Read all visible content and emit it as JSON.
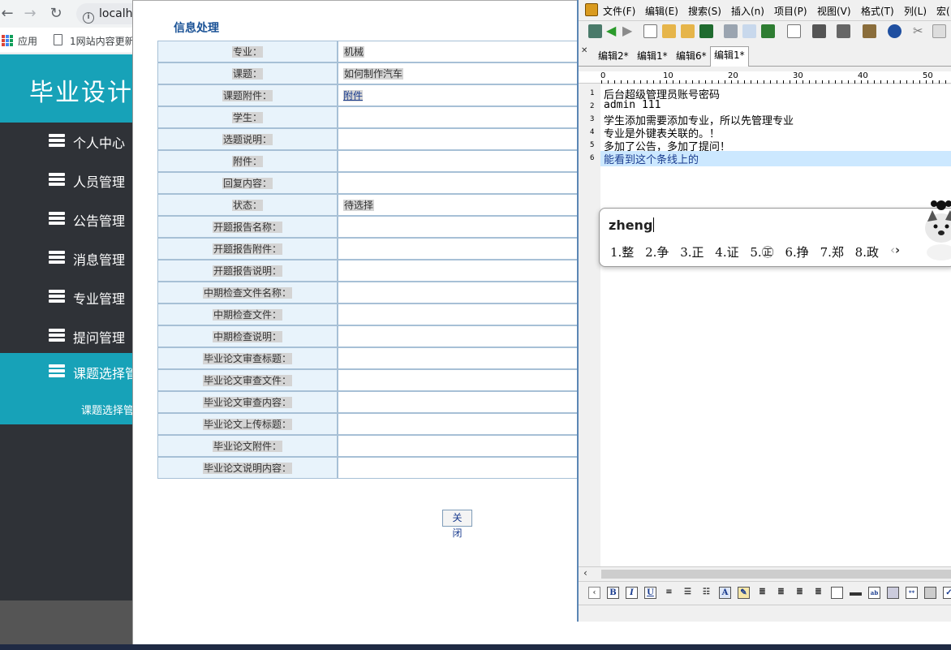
{
  "browser": {
    "back_icon": "arrow-left-icon",
    "forward_icon": "arrow-right-icon",
    "reload_icon": "reload-icon",
    "info_icon": "info-icon",
    "url": "localh",
    "apps_label": "应用",
    "bookmark_label": "1网站内容更新"
  },
  "app": {
    "title": "毕业设计",
    "sidebar": [
      {
        "label": "个人中心",
        "icon": "stack-icon"
      },
      {
        "label": "人员管理",
        "icon": "stack-icon"
      },
      {
        "label": "公告管理",
        "icon": "stack-icon"
      },
      {
        "label": "消息管理",
        "icon": "stack-icon"
      },
      {
        "label": "专业管理",
        "icon": "stack-icon"
      },
      {
        "label": "提问管理",
        "icon": "stack-icon"
      },
      {
        "label": "课题选择管",
        "icon": "stack-icon",
        "active": true
      }
    ],
    "sidebar_sub": "课题选择管"
  },
  "modal": {
    "title": "信息处理",
    "rows": [
      {
        "label": "专业：",
        "value": "机械"
      },
      {
        "label": "课题：",
        "value": "如何制作汽车"
      },
      {
        "label": "课题附件：",
        "value": "附件",
        "link": true
      },
      {
        "label": "学生：",
        "value": ""
      },
      {
        "label": "选题说明：",
        "value": ""
      },
      {
        "label": "附件：",
        "value": ""
      },
      {
        "label": "回复内容：",
        "value": ""
      },
      {
        "label": "状态：",
        "value": "待选择"
      },
      {
        "label": "开题报告名称：",
        "value": ""
      },
      {
        "label": "开题报告附件：",
        "value": ""
      },
      {
        "label": "开题报告说明：",
        "value": ""
      },
      {
        "label": "中期检查文件名称：",
        "value": ""
      },
      {
        "label": "中期检查文件：",
        "value": ""
      },
      {
        "label": "中期检查说明：",
        "value": ""
      },
      {
        "label": "毕业论文审查标题：",
        "value": ""
      },
      {
        "label": "毕业论文审查文件：",
        "value": ""
      },
      {
        "label": "毕业论文审查内容：",
        "value": ""
      },
      {
        "label": "毕业论文上传标题：",
        "value": ""
      },
      {
        "label": "毕业论文附件：",
        "value": ""
      },
      {
        "label": "毕业论文说明内容：",
        "value": ""
      }
    ],
    "close_label": "关 闭"
  },
  "editor": {
    "menu": [
      "文件(F)",
      "编辑(E)",
      "搜索(S)",
      "插入(n)",
      "项目(P)",
      "视图(V)",
      "格式(T)",
      "列(L)",
      "宏("
    ],
    "tabs": [
      {
        "label": "编辑2*",
        "active": false
      },
      {
        "label": "编辑1*",
        "active": false
      },
      {
        "label": "编辑6*",
        "active": false
      },
      {
        "label": "编辑1*",
        "active": true
      }
    ],
    "ruler_marks": [
      "0",
      "10",
      "20",
      "30",
      "40",
      "50"
    ],
    "lines": [
      {
        "num": "1",
        "text": "后台超级管理员账号密码"
      },
      {
        "num": "2",
        "text": "admin 111"
      },
      {
        "num": "3",
        "text": "学生添加需要添加专业，所以先管理专业"
      },
      {
        "num": "4",
        "text": "专业是外键表关联的。！"
      },
      {
        "num": "5",
        "text": "多加了公告，多加了提问！"
      },
      {
        "num": "6",
        "text": "能看到这个条线上的",
        "current": true
      }
    ],
    "fmt_buttons": [
      "B",
      "I",
      "U"
    ]
  },
  "ime": {
    "input": "zheng",
    "candidates": [
      "1.整",
      "2.争",
      "3.正",
      "4.证",
      "5.㊣",
      "6.挣",
      "7.郑",
      "8.政"
    ],
    "prev_icon": "chevron-left-icon",
    "next_icon": "chevron-right-icon",
    "mascot_icon": "husky-mascot-icon"
  },
  "colors": {
    "accent": "#17a2b8",
    "sidebar_bg": "#2f3237",
    "label_cell_bg": "#e8f3fb",
    "title_blue": "#1a5296",
    "current_line": "#cce8ff"
  }
}
